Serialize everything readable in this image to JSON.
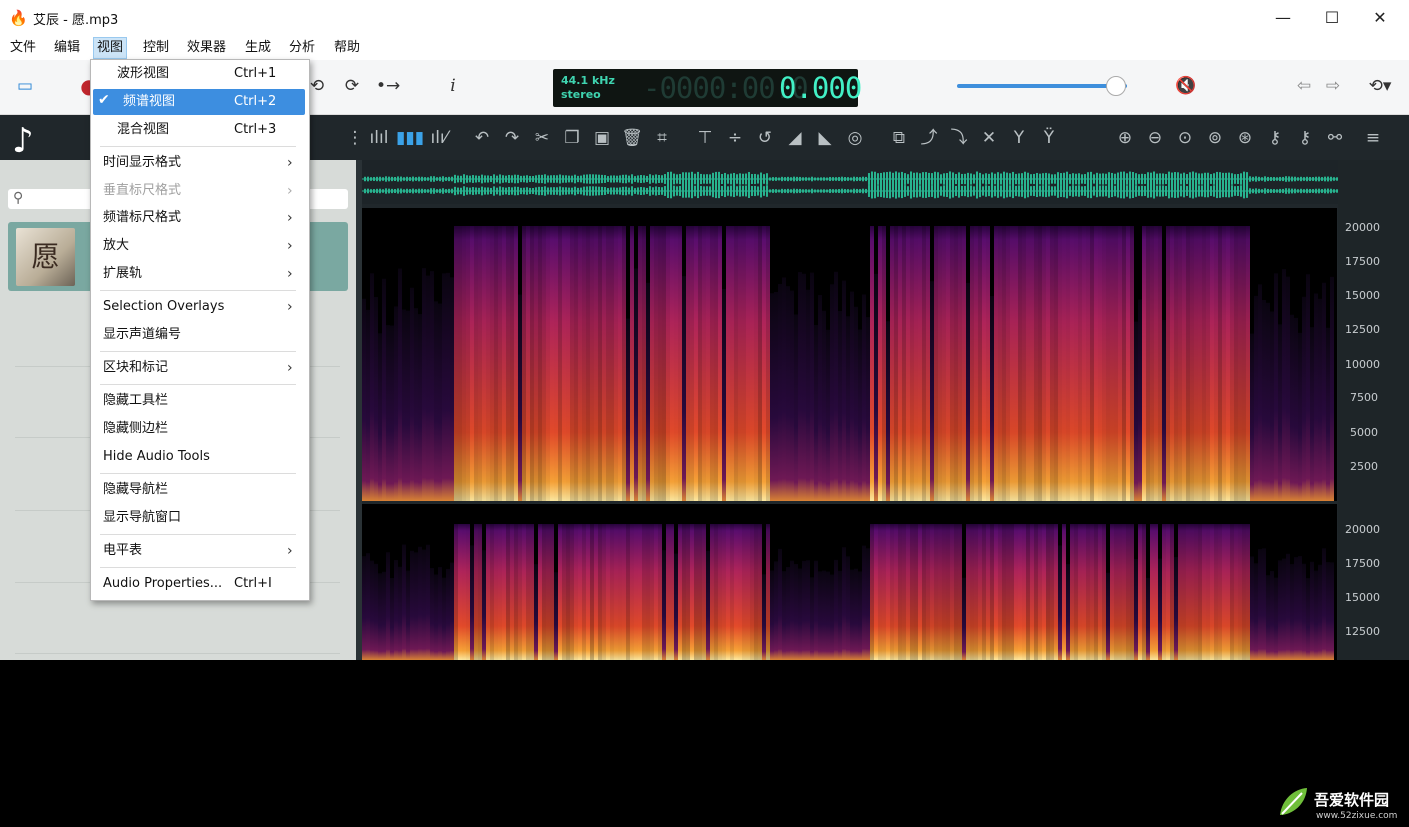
{
  "window": {
    "title": "艾辰 - 愿.mp3",
    "min_glyph": "—",
    "max_glyph": "☐",
    "close_glyph": "✕"
  },
  "menubar": [
    "文件",
    "编辑",
    "视图",
    "控制",
    "效果器",
    "生成",
    "分析",
    "帮助"
  ],
  "lcd": {
    "rate": "44.1 kHz",
    "channels": "stereo",
    "ghost": "-0000:00:0",
    "time": "0.000"
  },
  "player": {
    "volume_fraction": 0.93
  },
  "toolbar1": {
    "info_glyph": "i"
  },
  "sidebar": {
    "song_cover_char": "愿"
  },
  "ruler": {
    "top": [
      "20000",
      "17500",
      "15000",
      "12500",
      "10000",
      "7500",
      "5000",
      "2500"
    ],
    "bottom": [
      "20000",
      "17500",
      "15000",
      "12500"
    ]
  },
  "view_menu": {
    "items": [
      {
        "label": "波形视图",
        "shortcut": "Ctrl+1"
      },
      {
        "label": "频谱视图",
        "shortcut": "Ctrl+2",
        "checked": true
      },
      {
        "label": "混合视图",
        "shortcut": "Ctrl+3"
      },
      {
        "label": "时间显示格式",
        "submenu": true
      },
      {
        "label": "垂直标尺格式",
        "submenu": true,
        "disabled": true
      },
      {
        "label": "频谱标尺格式",
        "submenu": true
      },
      {
        "label": "放大",
        "submenu": true
      },
      {
        "label": "扩展轨",
        "submenu": true
      },
      {
        "label": "Selection Overlays",
        "submenu": true
      },
      {
        "label": "显示声道编号"
      },
      {
        "label": "区块和标记",
        "submenu": true
      },
      {
        "label": "隐藏工具栏"
      },
      {
        "label": "隐藏侧边栏"
      },
      {
        "label": "Hide Audio Tools"
      },
      {
        "label": "隐藏导航栏"
      },
      {
        "label": "显示导航窗口"
      },
      {
        "label": "电平表",
        "submenu": true
      },
      {
        "label": "Audio Properties...",
        "shortcut": "Ctrl+I"
      }
    ]
  },
  "watermark": {
    "name": "吾爱软件园",
    "url": "www.52zixue.com"
  },
  "colors": {
    "accent": "#3d8ee0",
    "waveform": "#28b38f",
    "lcd_text": "#42f0c6",
    "sidebar_bg": "#d7dbd8",
    "dark_bg": "#20272b"
  }
}
